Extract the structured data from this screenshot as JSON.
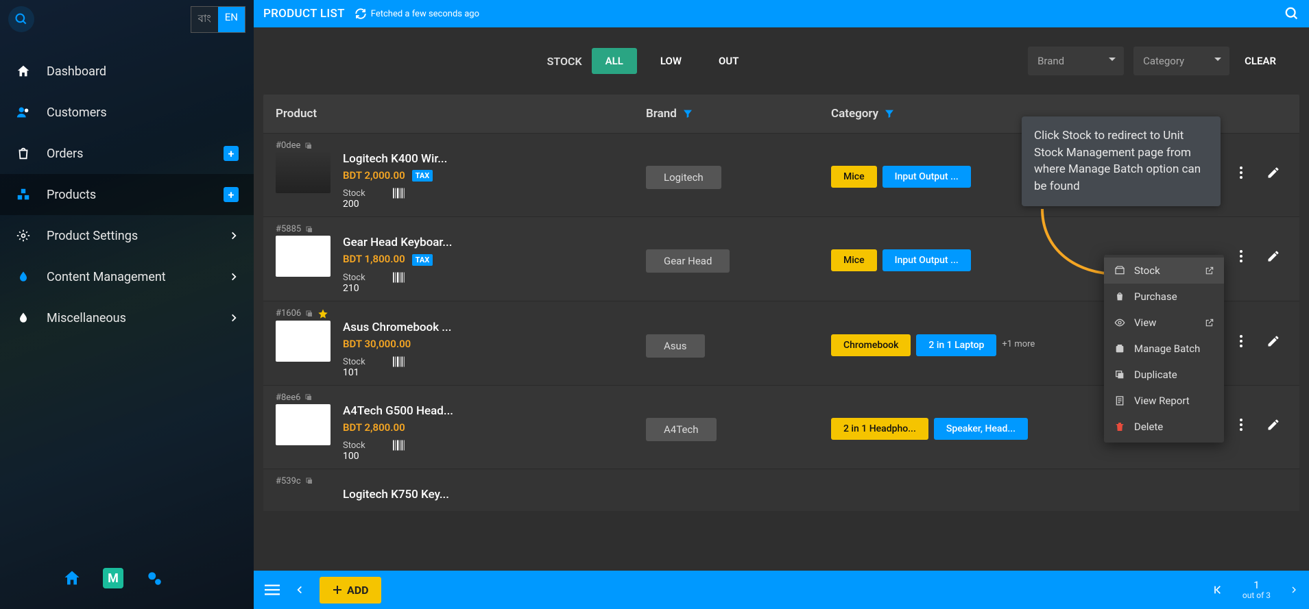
{
  "lang": {
    "option_a": "বাং",
    "option_b": "EN"
  },
  "sidebar": {
    "items": [
      {
        "label": "Dashboard"
      },
      {
        "label": "Customers"
      },
      {
        "label": "Orders"
      },
      {
        "label": "Products"
      },
      {
        "label": "Product Settings"
      },
      {
        "label": "Content Management"
      },
      {
        "label": "Miscellaneous"
      }
    ]
  },
  "topbar": {
    "title": "PRODUCT LIST",
    "fetched": "Fetched a few seconds ago"
  },
  "filters": {
    "stock_label": "STOCK",
    "all": "ALL",
    "low": "LOW",
    "out": "OUT",
    "brand_placeholder": "Brand",
    "category_placeholder": "Category",
    "clear": "CLEAR"
  },
  "headers": {
    "product": "Product",
    "brand": "Brand",
    "category": "Category"
  },
  "products": [
    {
      "id": "#0dee",
      "name": "Logitech K400 Wir...",
      "price": "BDT 2,000.00",
      "tax": "TAX",
      "stock_label": "Stock",
      "stock_value": "200",
      "brand": "Logitech",
      "cat_a": "Mice",
      "cat_b": "Input Output ..."
    },
    {
      "id": "#5885",
      "name": "Gear Head Keyboar...",
      "price": "BDT 1,800.00",
      "tax": "TAX",
      "stock_label": "Stock",
      "stock_value": "210",
      "brand": "Gear Head",
      "cat_a": "Mice",
      "cat_b": "Input Output ..."
    },
    {
      "id": "#1606",
      "starred": true,
      "name": "Asus Chromebook ...",
      "price": "BDT 30,000.00",
      "stock_label": "Stock",
      "stock_value": "101",
      "brand": "Asus",
      "cat_a": "Chromebook",
      "cat_b": "2 in 1 Laptop",
      "more": "+1 more"
    },
    {
      "id": "#8ee6",
      "name": "A4Tech G500 Head...",
      "price": "BDT 2,800.00",
      "stock_label": "Stock",
      "stock_value": "100",
      "brand": "A4Tech",
      "cat_a": "2 in 1 Headpho...",
      "cat_b": "Speaker, Head..."
    },
    {
      "id": "#539c",
      "name": "Logitech K750 Key..."
    }
  ],
  "callout": "Click Stock to redirect to Unit Stock Management page from where Manage Batch option can be found",
  "menu": {
    "stock": "Stock",
    "purchase": "Purchase",
    "view": "View",
    "manage_batch": "Manage Batch",
    "duplicate": "Duplicate",
    "view_report": "View Report",
    "delete": "Delete"
  },
  "footer": {
    "add": "ADD",
    "page": "1",
    "total": "out of 3"
  }
}
